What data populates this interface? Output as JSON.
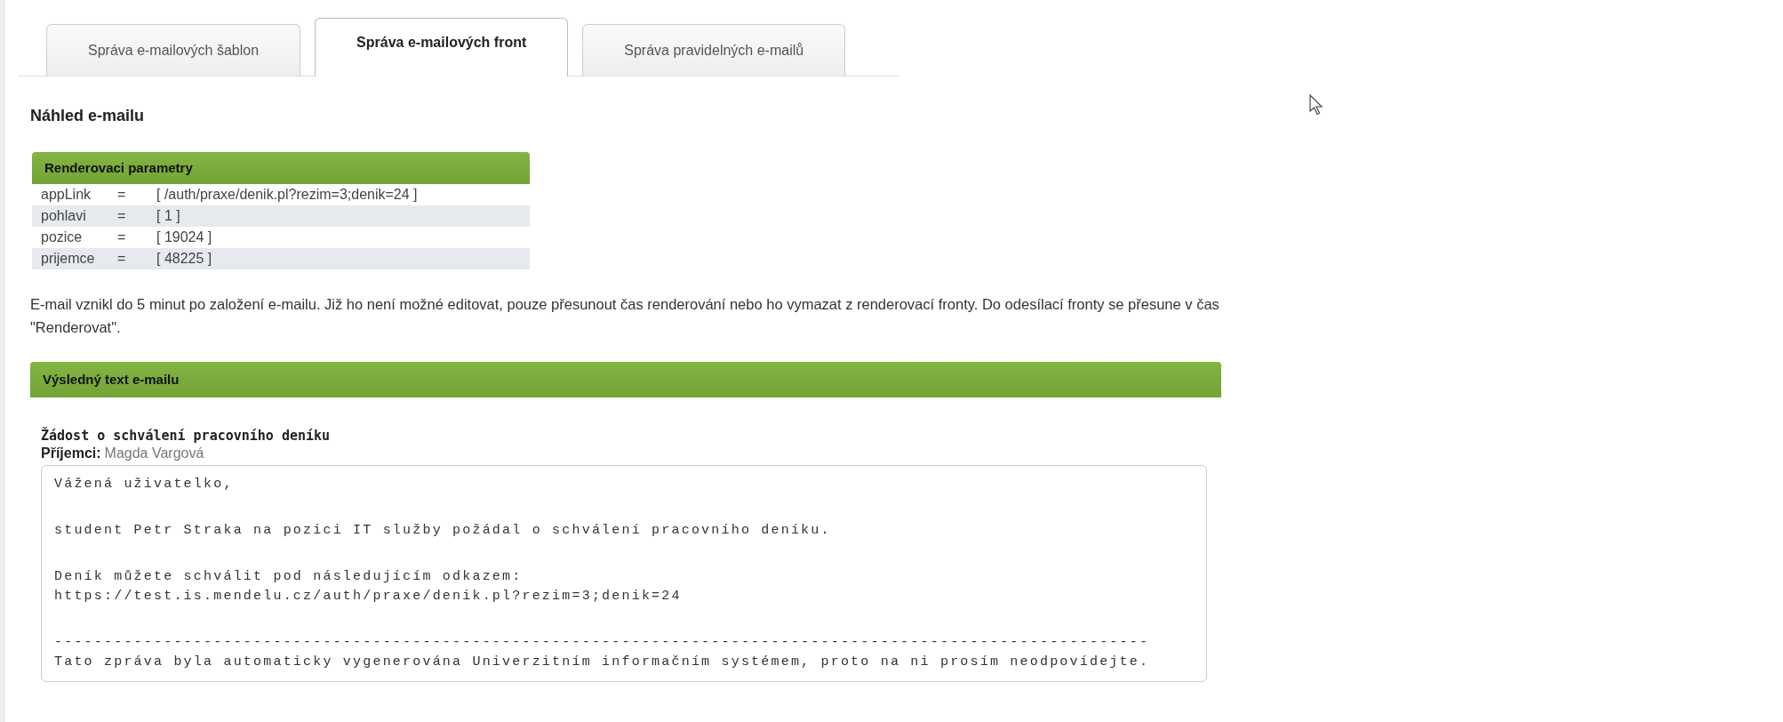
{
  "tabs": [
    {
      "label": "Správa e-mailových šablon",
      "selected": false
    },
    {
      "label": "Správa e-mailových front",
      "selected": true
    },
    {
      "label": "Správa pravidelných e-mailů",
      "selected": false
    }
  ],
  "heading": "Náhled e-mailu",
  "params": {
    "title": "Renderovaci parametry",
    "rows": [
      {
        "name": "appLink",
        "sign": "=",
        "value": "[ /auth/praxe/denik.pl?rezim=3;denik=24 ]"
      },
      {
        "name": "pohlavi",
        "sign": "=",
        "value": "[ 1 ]"
      },
      {
        "name": "pozice",
        "sign": "=",
        "value": "[ 19024 ]"
      },
      {
        "name": "prijemce",
        "sign": "=",
        "value": "[ 48225 ]"
      }
    ]
  },
  "note": "E-mail vznikl do 5 minut po založení e-mailu. Již ho není možné editovat, pouze přesunout čas renderování nebo ho vymazat z renderovací fronty. Do odesílací fronty se přesune v čas \"Renderovat\".",
  "result": {
    "title": "Výsledný text e-mailu",
    "subject": "Žádost o schválení pracovního deníku",
    "recipient_label": "Příjemci:",
    "recipient": "Magda Vargová",
    "body": [
      {
        "lines": [
          "Vážená uživatelko,"
        ]
      },
      {
        "lines": [
          "student Petr Straka na pozici IT služby požádal o schválení pracovního deníku."
        ]
      },
      {
        "lines": [
          "Deník můžete schválit pod následujícím odkazem:",
          "https://test.is.mendelu.cz/auth/praxe/denik.pl?rezim=3;denik=24"
        ]
      },
      {
        "lines": [
          "--------------------------------------------------------------------------------------------------------------",
          "Tato zpráva byla automaticky vygenerována Univerzitním informačním systémem, proto na ni prosím neodpovídejte."
        ]
      }
    ]
  }
}
